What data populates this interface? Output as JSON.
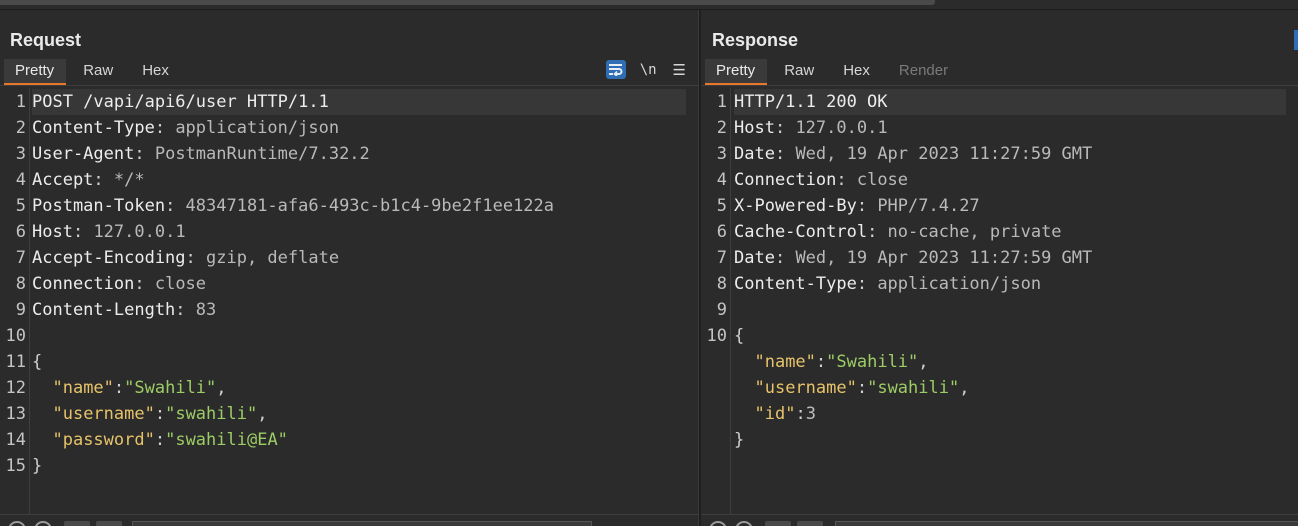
{
  "request": {
    "title": "Request",
    "tabs": [
      {
        "label": "Pretty",
        "active": true
      },
      {
        "label": "Raw"
      },
      {
        "label": "Hex"
      }
    ],
    "toolbar": {
      "wrap_icon": "wrap-lines-icon",
      "newline_label": "\\n",
      "menu_icon": "hamburger-menu-icon"
    },
    "lines": [
      {
        "n": "1",
        "parts": [
          {
            "t": "POST /vapi/api6/user HTTP/1.1",
            "c": "hname"
          }
        ]
      },
      {
        "n": "2",
        "parts": [
          {
            "t": "Content-Type",
            "c": "hname"
          },
          {
            "t": ": ",
            "c": "punc"
          },
          {
            "t": "application/json",
            "c": "hval"
          }
        ]
      },
      {
        "n": "3",
        "parts": [
          {
            "t": "User-Agent",
            "c": "hname"
          },
          {
            "t": ": ",
            "c": "punc"
          },
          {
            "t": "PostmanRuntime/7.32.2",
            "c": "hval"
          }
        ]
      },
      {
        "n": "4",
        "parts": [
          {
            "t": "Accept",
            "c": "hname"
          },
          {
            "t": ": ",
            "c": "punc"
          },
          {
            "t": "*/*",
            "c": "hval"
          }
        ]
      },
      {
        "n": "5",
        "parts": [
          {
            "t": "Postman-Token",
            "c": "hname"
          },
          {
            "t": ": ",
            "c": "punc"
          },
          {
            "t": "48347181-afa6-493c-b1c4-9be2f1ee122a",
            "c": "hval"
          }
        ]
      },
      {
        "n": "6",
        "parts": [
          {
            "t": "Host",
            "c": "hname"
          },
          {
            "t": ": ",
            "c": "punc"
          },
          {
            "t": "127.0.0.1",
            "c": "hval"
          }
        ]
      },
      {
        "n": "7",
        "parts": [
          {
            "t": "Accept-Encoding",
            "c": "hname"
          },
          {
            "t": ": ",
            "c": "punc"
          },
          {
            "t": "gzip, deflate",
            "c": "hval"
          }
        ]
      },
      {
        "n": "8",
        "parts": [
          {
            "t": "Connection",
            "c": "hname"
          },
          {
            "t": ": ",
            "c": "punc"
          },
          {
            "t": "close",
            "c": "hval"
          }
        ]
      },
      {
        "n": "9",
        "parts": [
          {
            "t": "Content-Length",
            "c": "hname"
          },
          {
            "t": ": ",
            "c": "punc"
          },
          {
            "t": "83",
            "c": "hval"
          }
        ]
      },
      {
        "n": "10",
        "parts": []
      },
      {
        "n": "11",
        "parts": [
          {
            "t": "{",
            "c": "punc"
          }
        ]
      },
      {
        "n": "12",
        "parts": [
          {
            "t": "  ",
            "c": "punc"
          },
          {
            "t": "\"name\"",
            "c": "jkey"
          },
          {
            "t": ":",
            "c": "punc"
          },
          {
            "t": "\"Swahili\"",
            "c": "jstr"
          },
          {
            "t": ",",
            "c": "punc"
          }
        ]
      },
      {
        "n": "13",
        "parts": [
          {
            "t": "  ",
            "c": "punc"
          },
          {
            "t": "\"username\"",
            "c": "jkey"
          },
          {
            "t": ":",
            "c": "punc"
          },
          {
            "t": "\"swahili\"",
            "c": "jstr"
          },
          {
            "t": ",",
            "c": "punc"
          }
        ]
      },
      {
        "n": "14",
        "parts": [
          {
            "t": "  ",
            "c": "punc"
          },
          {
            "t": "\"password\"",
            "c": "jkey"
          },
          {
            "t": ":",
            "c": "punc"
          },
          {
            "t": "\"swahili@EA\"",
            "c": "jstr"
          }
        ]
      },
      {
        "n": "15",
        "parts": [
          {
            "t": "}",
            "c": "punc"
          }
        ]
      }
    ]
  },
  "response": {
    "title": "Response",
    "tabs": [
      {
        "label": "Pretty",
        "active": true
      },
      {
        "label": "Raw"
      },
      {
        "label": "Hex"
      },
      {
        "label": "Render",
        "disabled": true
      }
    ],
    "lines": [
      {
        "n": "1",
        "parts": [
          {
            "t": "HTTP/1.1 200 OK",
            "c": "hname"
          }
        ]
      },
      {
        "n": "2",
        "parts": [
          {
            "t": "Host",
            "c": "hname"
          },
          {
            "t": ": ",
            "c": "punc"
          },
          {
            "t": "127.0.0.1",
            "c": "hval"
          }
        ]
      },
      {
        "n": "3",
        "parts": [
          {
            "t": "Date",
            "c": "hname"
          },
          {
            "t": ": ",
            "c": "punc"
          },
          {
            "t": "Wed, 19 Apr 2023 11:27:59 GMT",
            "c": "hval"
          }
        ]
      },
      {
        "n": "4",
        "parts": [
          {
            "t": "Connection",
            "c": "hname"
          },
          {
            "t": ": ",
            "c": "punc"
          },
          {
            "t": "close",
            "c": "hval"
          }
        ]
      },
      {
        "n": "5",
        "parts": [
          {
            "t": "X-Powered-By",
            "c": "hname"
          },
          {
            "t": ": ",
            "c": "punc"
          },
          {
            "t": "PHP/7.4.27",
            "c": "hval"
          }
        ]
      },
      {
        "n": "6",
        "parts": [
          {
            "t": "Cache-Control",
            "c": "hname"
          },
          {
            "t": ": ",
            "c": "punc"
          },
          {
            "t": "no-cache, private",
            "c": "hval"
          }
        ]
      },
      {
        "n": "7",
        "parts": [
          {
            "t": "Date",
            "c": "hname"
          },
          {
            "t": ": ",
            "c": "punc"
          },
          {
            "t": "Wed, 19 Apr 2023 11:27:59 GMT",
            "c": "hval"
          }
        ]
      },
      {
        "n": "8",
        "parts": [
          {
            "t": "Content-Type",
            "c": "hname"
          },
          {
            "t": ": ",
            "c": "punc"
          },
          {
            "t": "application/json",
            "c": "hval"
          }
        ]
      },
      {
        "n": "9",
        "parts": []
      },
      {
        "n": "10",
        "parts": [
          {
            "t": "{",
            "c": "punc"
          }
        ]
      },
      {
        "n": "",
        "parts": [
          {
            "t": "  ",
            "c": "punc"
          },
          {
            "t": "\"name\"",
            "c": "jkey"
          },
          {
            "t": ":",
            "c": "punc"
          },
          {
            "t": "\"Swahili\"",
            "c": "jstr"
          },
          {
            "t": ",",
            "c": "punc"
          }
        ]
      },
      {
        "n": "",
        "parts": [
          {
            "t": "  ",
            "c": "punc"
          },
          {
            "t": "\"username\"",
            "c": "jkey"
          },
          {
            "t": ":",
            "c": "punc"
          },
          {
            "t": "\"swahili\"",
            "c": "jstr"
          },
          {
            "t": ",",
            "c": "punc"
          }
        ]
      },
      {
        "n": "",
        "parts": [
          {
            "t": "  ",
            "c": "punc"
          },
          {
            "t": "\"id\"",
            "c": "jkey"
          },
          {
            "t": ":",
            "c": "punc"
          },
          {
            "t": "3",
            "c": "jnum"
          }
        ]
      },
      {
        "n": "",
        "parts": [
          {
            "t": "}",
            "c": "punc"
          }
        ]
      }
    ]
  },
  "colors": {
    "accent_tab_underline": "#e8772e",
    "toolbar_active_icon_bg": "#2f6db5"
  }
}
